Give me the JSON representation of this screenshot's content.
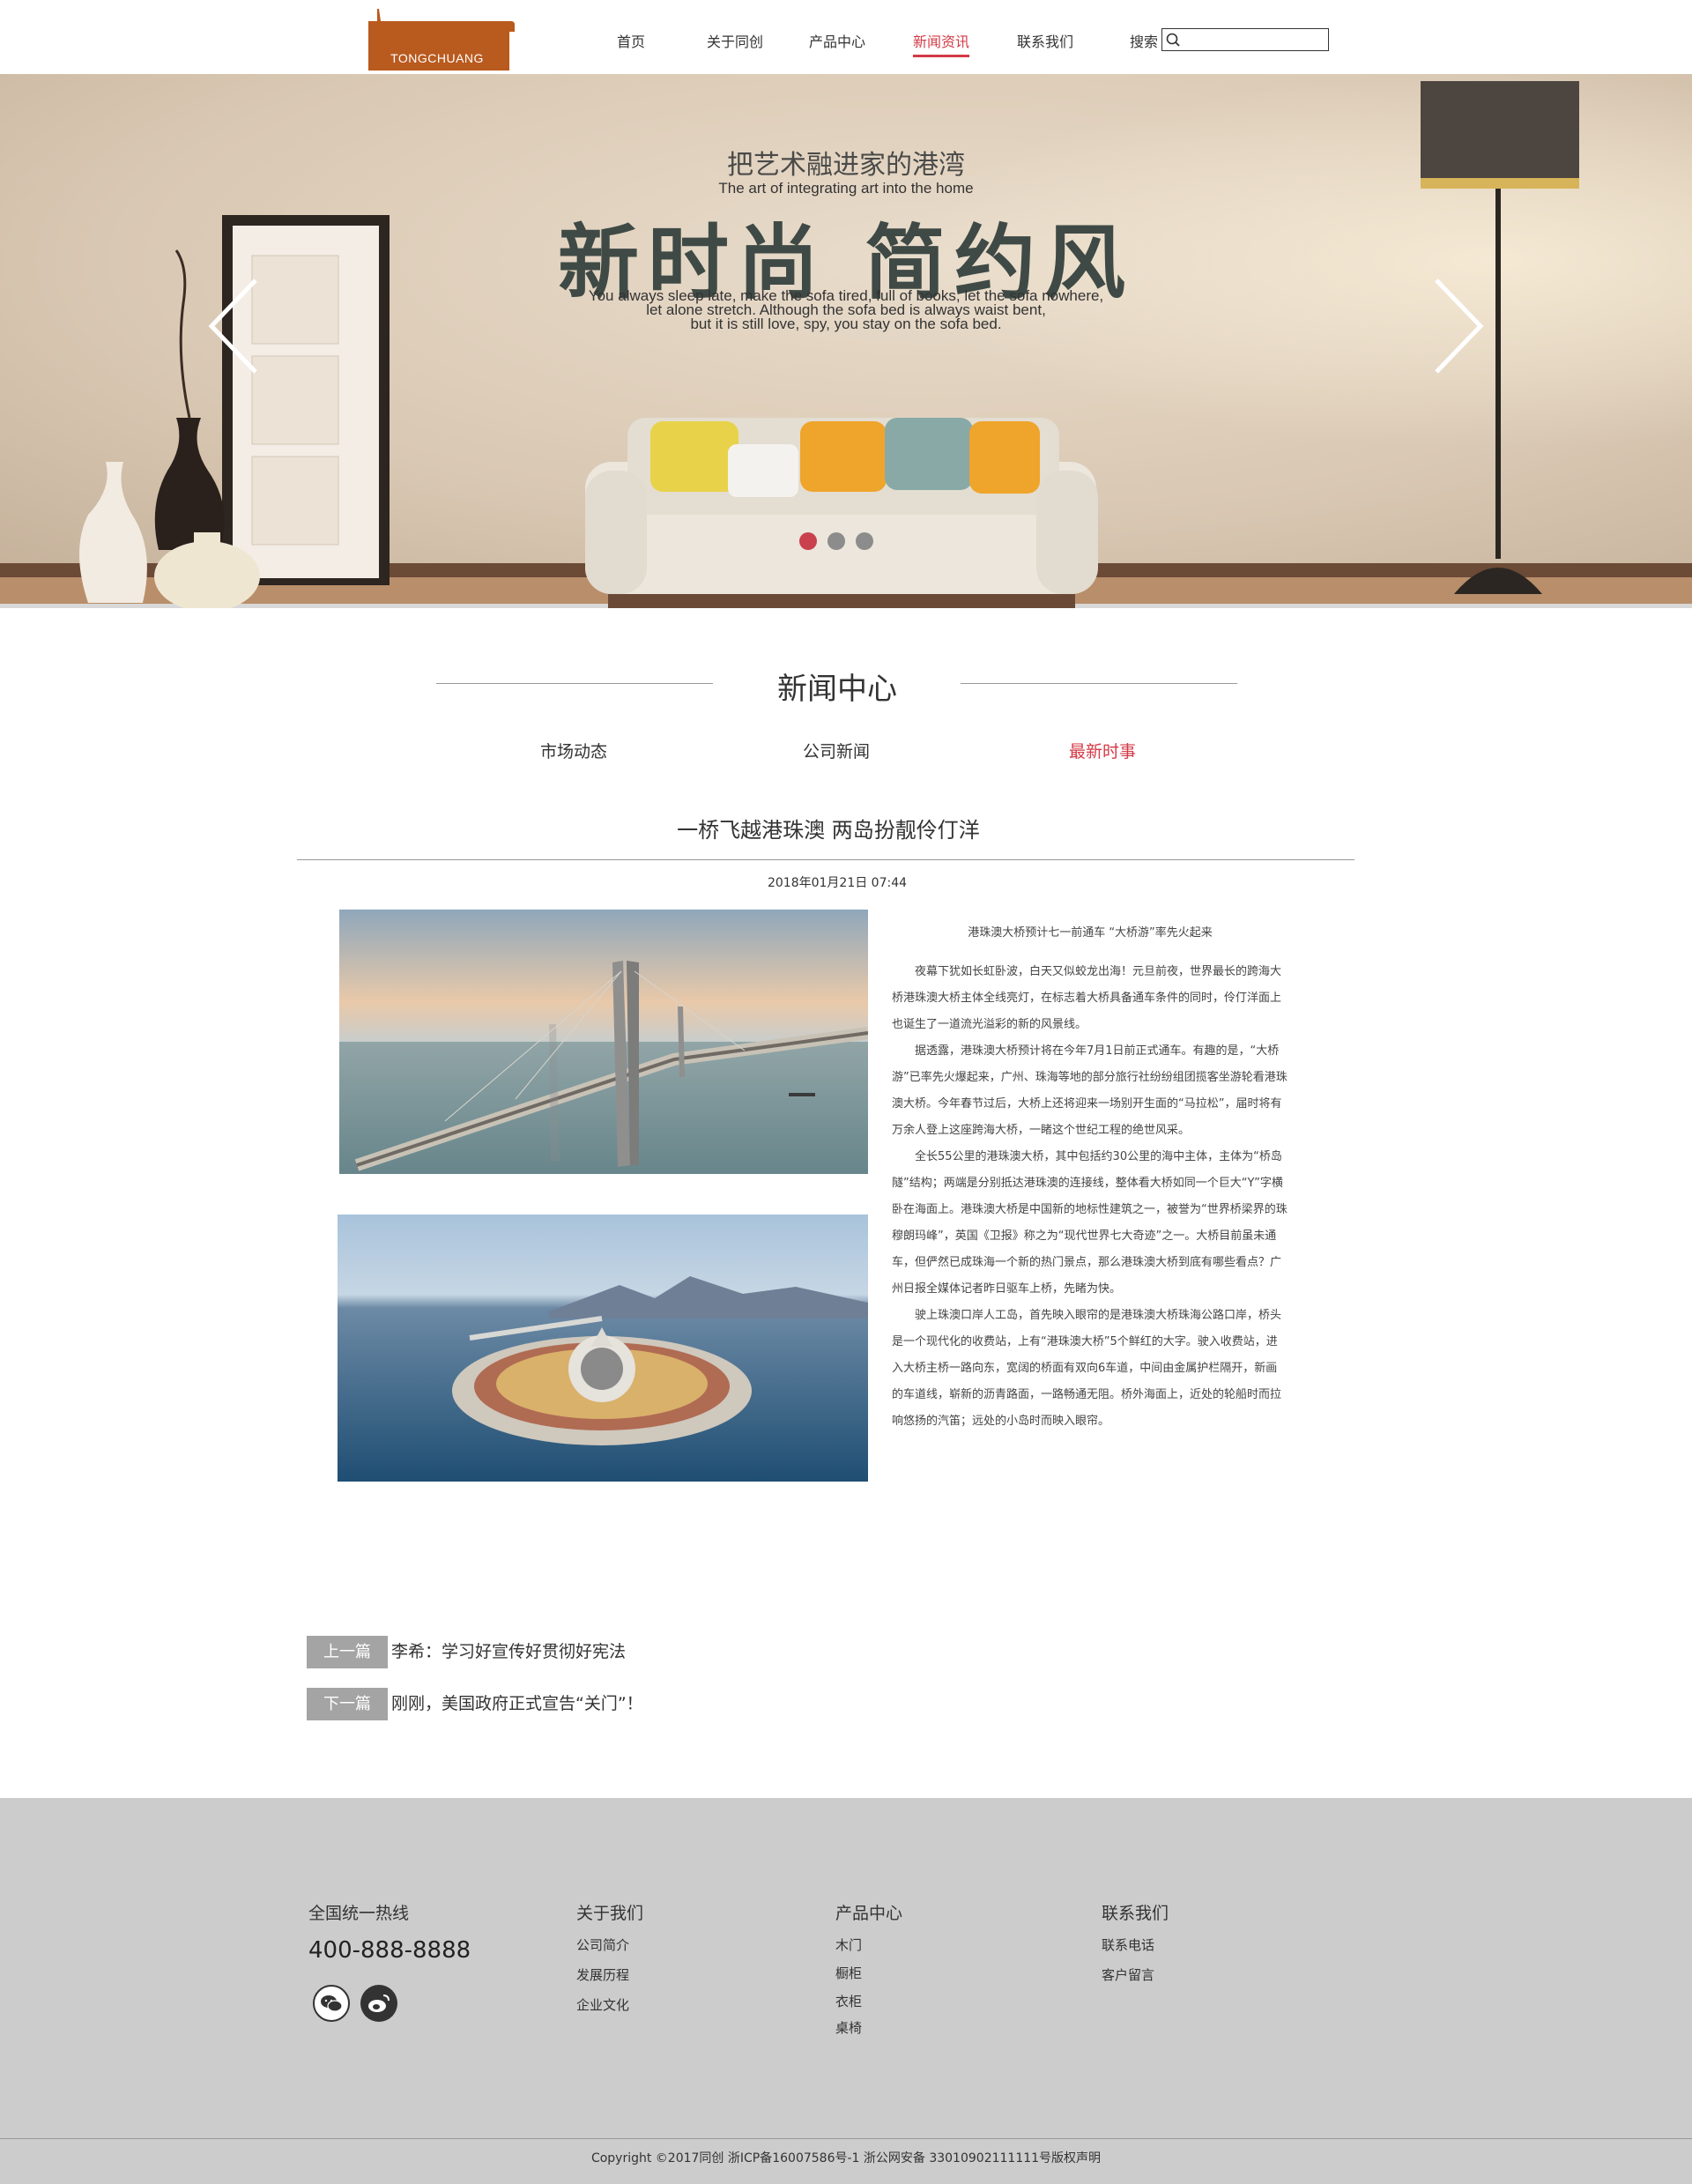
{
  "header": {
    "logo_text": "TONGCHUANG",
    "nav": [
      "首页",
      "关于同创",
      "产品中心",
      "新闻资讯",
      "联系我们"
    ],
    "active_nav": "新闻资讯",
    "search_label": "搜索",
    "search_value": ""
  },
  "banner": {
    "subtitle": "把艺术融进家的港湾",
    "subtitle_en": "The art of integrating art into the home",
    "title": "新时尚  简约风",
    "body_lines": [
      "You always sleep late, make the sofa tired, full of books, let the sofa nowhere,",
      "let alone stretch. Although the sofa bed is always waist bent,",
      "but it is still love, spy, you stay on the sofa bed."
    ],
    "slides": 3,
    "active_slide": 1,
    "colors": {
      "dot_active": "#c9414d",
      "dot_inactive": "#8c8c8c"
    }
  },
  "news": {
    "section_title": "新闻中心",
    "categories": [
      "市场动态",
      "公司新闻",
      "最新时事"
    ],
    "active_category": "最新时事",
    "article": {
      "title": "一桥飞越港珠澳 两岛扮靓伶仃洋",
      "date": "2018年01月21日 07:44",
      "headline": "港珠澳大桥预计七一前通车 “大桥游”率先火起来",
      "paragraphs": [
        "夜幕下犹如长虹卧波，白天又似蛟龙出海！元旦前夜，世界最长的跨海大桥港珠澳大桥主体全线亮灯，在标志着大桥具备通车条件的同时，伶仃洋面上也诞生了一道流光溢彩的新的风景线。",
        "据透露，港珠澳大桥预计将在今年7月1日前正式通车。有趣的是，“大桥游”已率先火爆起来，广州、珠海等地的部分旅行社纷纷组团揽客坐游轮看港珠澳大桥。今年春节过后，大桥上还将迎来一场别开生面的“马拉松”，届时将有万余人登上这座跨海大桥，一睹这个世纪工程的绝世风采。",
        "全长55公里的港珠澳大桥，其中包括约30公里的海中主体，主体为“桥岛隧”结构；两端是分别抵达港珠澳的连接线，整体看大桥如同一个巨大“Y”字横卧在海面上。港珠澳大桥是中国新的地标性建筑之一，被誉为“世界桥梁界的珠穆朗玛峰”，英国《卫报》称之为“现代世界七大奇迹”之一。大桥目前虽未通车，但俨然已成珠海一个新的热门景点，那么港珠澳大桥到底有哪些看点？广州日报全媒体记者昨日驱车上桥，先睹为快。",
        "驶上珠澳口岸人工岛，首先映入眼帘的是港珠澳大桥珠海公路口岸，桥头是一个现代化的收费站，上有“港珠澳大桥”5个鲜红的大字。驶入收费站，进入大桥主桥一路向东，宽阔的桥面有双向6车道，中间由金属护栏隔开，新画的车道线，崭新的沥青路面，一路畅通无阻。桥外海面上，近处的轮船时而拉响悠扬的汽笛；远处的小岛时而映入眼帘。"
      ]
    },
    "prev_label": "上一篇",
    "prev_title": "李希：学习好宣传好贯彻好宪法",
    "next_label": "下一篇",
    "next_title": "刚刚，美国政府正式宣告“关门”！"
  },
  "footer": {
    "hotline_title": "全国统一热线",
    "hotline": "400-888-8888",
    "columns": [
      {
        "title": "关于我们",
        "items": [
          "公司简介",
          "发展历程",
          "企业文化"
        ]
      },
      {
        "title": "产品中心",
        "items": [
          "木门",
          "橱柜",
          "衣柜",
          "桌椅"
        ]
      },
      {
        "title": "联系我们",
        "items": [
          "联系电话",
          "客户留言"
        ]
      }
    ],
    "social_icons": [
      "wechat-icon",
      "weibo-icon"
    ],
    "copyright": "Copyright ©2017同创   浙ICP备16007586号-1  浙公网安备 33010902111111号版权声明"
  },
  "colors": {
    "accent": "#d33a46",
    "logo": "#b95a1e",
    "footer_bg": "#cccccc",
    "pager_btn": "#a4a4a4"
  }
}
